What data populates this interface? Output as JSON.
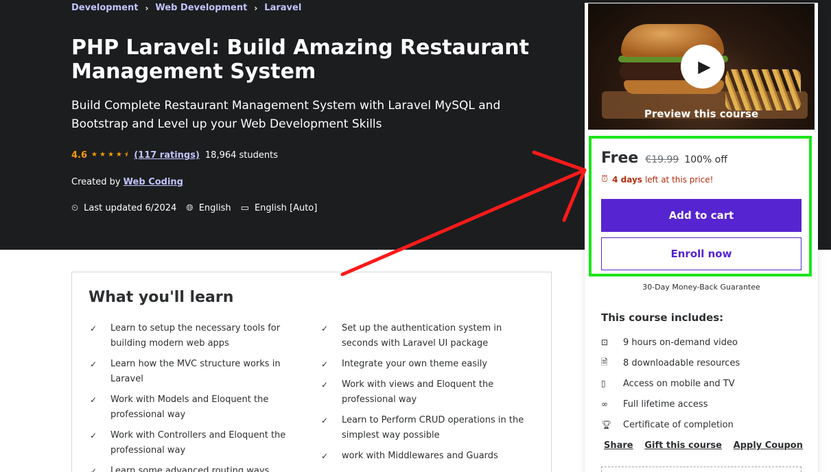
{
  "breadcrumb": [
    "Development",
    "Web Development",
    "Laravel"
  ],
  "course": {
    "title": "PHP Laravel: Build Amazing Restaurant Management System",
    "subtitle": "Build Complete Restaurant Management System with Laravel MySQL and Bootstrap and Level up your Web Development Skills",
    "rating": "4.6",
    "stars": 4.5,
    "ratings_count": "(117 ratings)",
    "students": "18,964 students",
    "created_by_label": "Created by",
    "author": "Web Coding",
    "last_updated": "Last updated 6/2024",
    "language": "English",
    "captions": "English [Auto]"
  },
  "learn": {
    "title": "What you'll learn",
    "left": [
      "Learn to setup the necessary tools for building modern web apps",
      "Learn how the MVC structure works in Laravel",
      "Work with Models and Eloquent the professional way",
      "Work with Controllers and Eloquent the professional way",
      "Learn some advanced routing ways"
    ],
    "right": [
      "Set up the authentication system in seconds with Laravel UI package",
      "Integrate your own theme easily",
      "Work with views and Eloquent the professional way",
      "Learn to Perform CRUD operations in the simplest way possible",
      "work with Middlewares and Guards"
    ]
  },
  "sidebar": {
    "preview_label": "Preview this course",
    "price": "Free",
    "original_price": "€19.99",
    "discount": "100% off",
    "timer_bold": "4 days",
    "timer_rest": "left at this price!",
    "add_to_cart": "Add to cart",
    "enroll_now": "Enroll now",
    "guarantee": "30-Day Money-Back Guarantee",
    "includes_title": "This course includes:",
    "includes": [
      {
        "icon": "video-icon",
        "text": "9 hours on-demand video"
      },
      {
        "icon": "file-download-icon",
        "text": "8 downloadable resources"
      },
      {
        "icon": "mobile-icon",
        "text": "Access on mobile and TV"
      },
      {
        "icon": "infinity-icon",
        "text": "Full lifetime access"
      },
      {
        "icon": "trophy-icon",
        "text": "Certificate of completion"
      }
    ],
    "actions": [
      "Share",
      "Gift this course",
      "Apply Coupon"
    ]
  },
  "colors": {
    "hero_bg": "#1c1d1f",
    "link": "#c0c4fc",
    "star": "#f69c08",
    "primary": "#5624d0",
    "alert": "#b32d0f",
    "annotation_green": "#19e619",
    "annotation_red": "#ff1a1a"
  }
}
